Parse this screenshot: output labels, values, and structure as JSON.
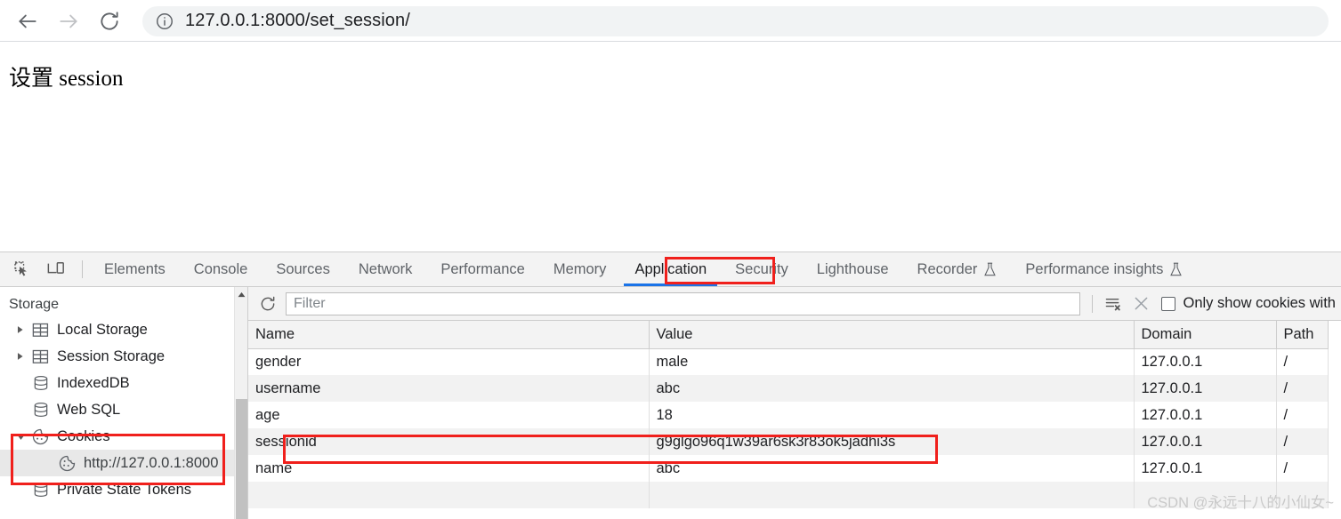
{
  "browser": {
    "back_label": "Back",
    "forward_label": "Forward",
    "reload_label": "Reload",
    "site_info_label": "View site information",
    "url": "127.0.0.1:8000/set_session/"
  },
  "page": {
    "heading": "设置 session"
  },
  "devtools": {
    "inspect_label": "Inspect element",
    "device_toolbar_label": "Toggle device toolbar",
    "tabs": [
      {
        "label": "Elements",
        "active": false,
        "experimental": false
      },
      {
        "label": "Console",
        "active": false,
        "experimental": false
      },
      {
        "label": "Sources",
        "active": false,
        "experimental": false
      },
      {
        "label": "Network",
        "active": false,
        "experimental": false
      },
      {
        "label": "Performance",
        "active": false,
        "experimental": false
      },
      {
        "label": "Memory",
        "active": false,
        "experimental": false
      },
      {
        "label": "Application",
        "active": true,
        "experimental": false
      },
      {
        "label": "Security",
        "active": false,
        "experimental": false
      },
      {
        "label": "Lighthouse",
        "active": false,
        "experimental": false
      },
      {
        "label": "Recorder",
        "active": false,
        "experimental": true
      },
      {
        "label": "Performance insights",
        "active": false,
        "experimental": true
      }
    ],
    "sidebar": {
      "section_title": "Storage",
      "items": [
        {
          "label": "Local Storage",
          "icon": "table-icon",
          "twisty": "collapsed",
          "indent": 0,
          "selected": false
        },
        {
          "label": "Session Storage",
          "icon": "table-icon",
          "twisty": "collapsed",
          "indent": 0,
          "selected": false
        },
        {
          "label": "IndexedDB",
          "icon": "database-icon",
          "twisty": "none",
          "indent": 0,
          "selected": false
        },
        {
          "label": "Web SQL",
          "icon": "database-icon",
          "twisty": "none",
          "indent": 0,
          "selected": false
        },
        {
          "label": "Cookies",
          "icon": "cookie-icon",
          "twisty": "expanded",
          "indent": 0,
          "selected": false
        },
        {
          "label": "http://127.0.0.1:8000",
          "icon": "cookie-icon",
          "twisty": "none",
          "indent": 1,
          "selected": true
        },
        {
          "label": "Private State Tokens",
          "icon": "database-icon",
          "twisty": "none",
          "indent": 0,
          "selected": false
        }
      ]
    },
    "cookie_toolbar": {
      "refresh_label": "Refresh",
      "filter_placeholder": "Filter",
      "filter_value": "",
      "clear_all_label": "Clear all cookies",
      "delete_selected_label": "Delete selected cookie",
      "only_show_label": "Only show cookies with",
      "only_show_checked": false
    },
    "cookie_table": {
      "columns": [
        "Name",
        "Value",
        "Domain",
        "Path"
      ],
      "rows": [
        {
          "name": "gender",
          "value": "male",
          "domain": "127.0.0.1",
          "path": "/",
          "highlighted": false
        },
        {
          "name": "username",
          "value": "abc",
          "domain": "127.0.0.1",
          "path": "/",
          "highlighted": false
        },
        {
          "name": "age",
          "value": "18",
          "domain": "127.0.0.1",
          "path": "/",
          "highlighted": false
        },
        {
          "name": "sessionid",
          "value": "g9glgo96q1w39ar6sk3r83ok5jadhi3s",
          "domain": "127.0.0.1",
          "path": "/",
          "highlighted": true
        },
        {
          "name": "name",
          "value": "abc",
          "domain": "127.0.0.1",
          "path": "/",
          "highlighted": false
        }
      ]
    }
  },
  "annotations": {
    "color": "#f0201c",
    "boxes": [
      "application-tab",
      "cookies-tree-group",
      "sessionid-row"
    ]
  },
  "watermark": "CSDN @永远十八的小仙女~"
}
